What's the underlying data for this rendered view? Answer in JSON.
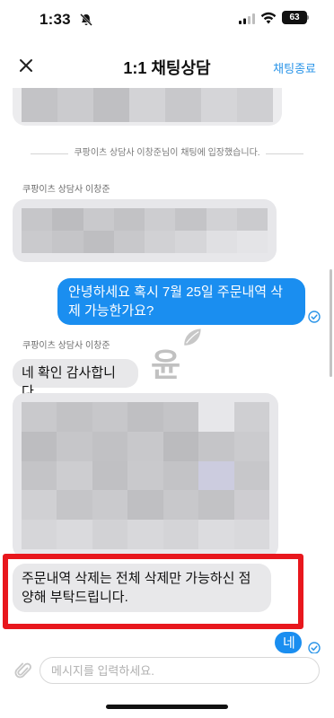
{
  "status_bar": {
    "time": "1:33",
    "battery": "63"
  },
  "header": {
    "title": "1:1 채팅상담",
    "end_chat": "채팅종료"
  },
  "system_message": "쿠팡이츠 상담사 이창준님이 채팅에 입장했습니다.",
  "agent_name": "쿠팡이츠 상담사 이창준",
  "messages": {
    "user_question": "안녕하세요 혹시 7월 25일 주문내역 삭제 가능한가요?",
    "agent_thanks": "네 확인 감사합니다.",
    "agent_answer": "주문내역 삭제는 전체 삭제만 가능하신 점 양해 부탁드립니다.",
    "user_reply": "네"
  },
  "watermark": "윤",
  "input": {
    "placeholder": "메시지를 입력하세요."
  },
  "colors": {
    "accent": "#2b95e8",
    "user_bubble": "#1a8ef0",
    "agent_bubble": "#e8e8ea",
    "highlight": "#e8171d"
  },
  "icons": [
    "close-icon",
    "bell-slash-icon",
    "signal-icon",
    "wifi-icon",
    "battery-icon",
    "check-circle-icon",
    "paperclip-icon",
    "leaf-icon"
  ]
}
